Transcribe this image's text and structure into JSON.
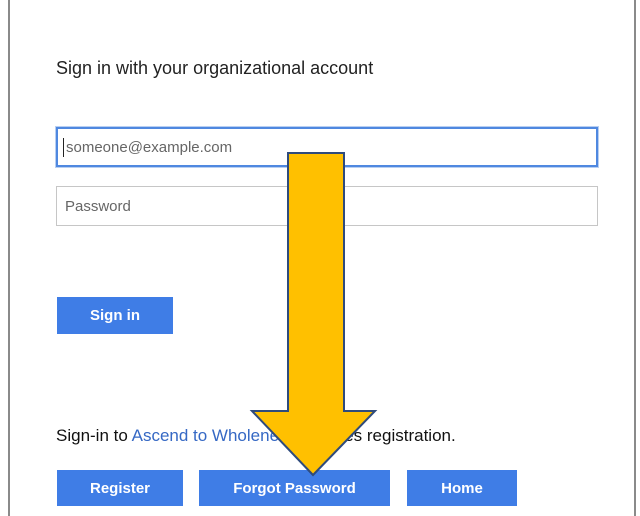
{
  "signin": {
    "heading": "Sign in with your organizational account",
    "username_placeholder": "someone@example.com",
    "password_placeholder": "Password",
    "signin_button": "Sign in"
  },
  "registration": {
    "prefix": "Sign-in to ",
    "link_text": "Ascend to Wholeness",
    "suffix": " requires registration."
  },
  "buttons": {
    "register": "Register",
    "forgot_password": "Forgot Password",
    "home": "Home"
  },
  "annotation": {
    "arrow_icon": "down-arrow-icon",
    "arrow_fill": "#FFC000",
    "arrow_stroke": "#2F4B7C"
  },
  "colors": {
    "button_blue": "#3F7DE6",
    "link_blue": "#3568C4",
    "focus_border": "#4F88E0"
  }
}
